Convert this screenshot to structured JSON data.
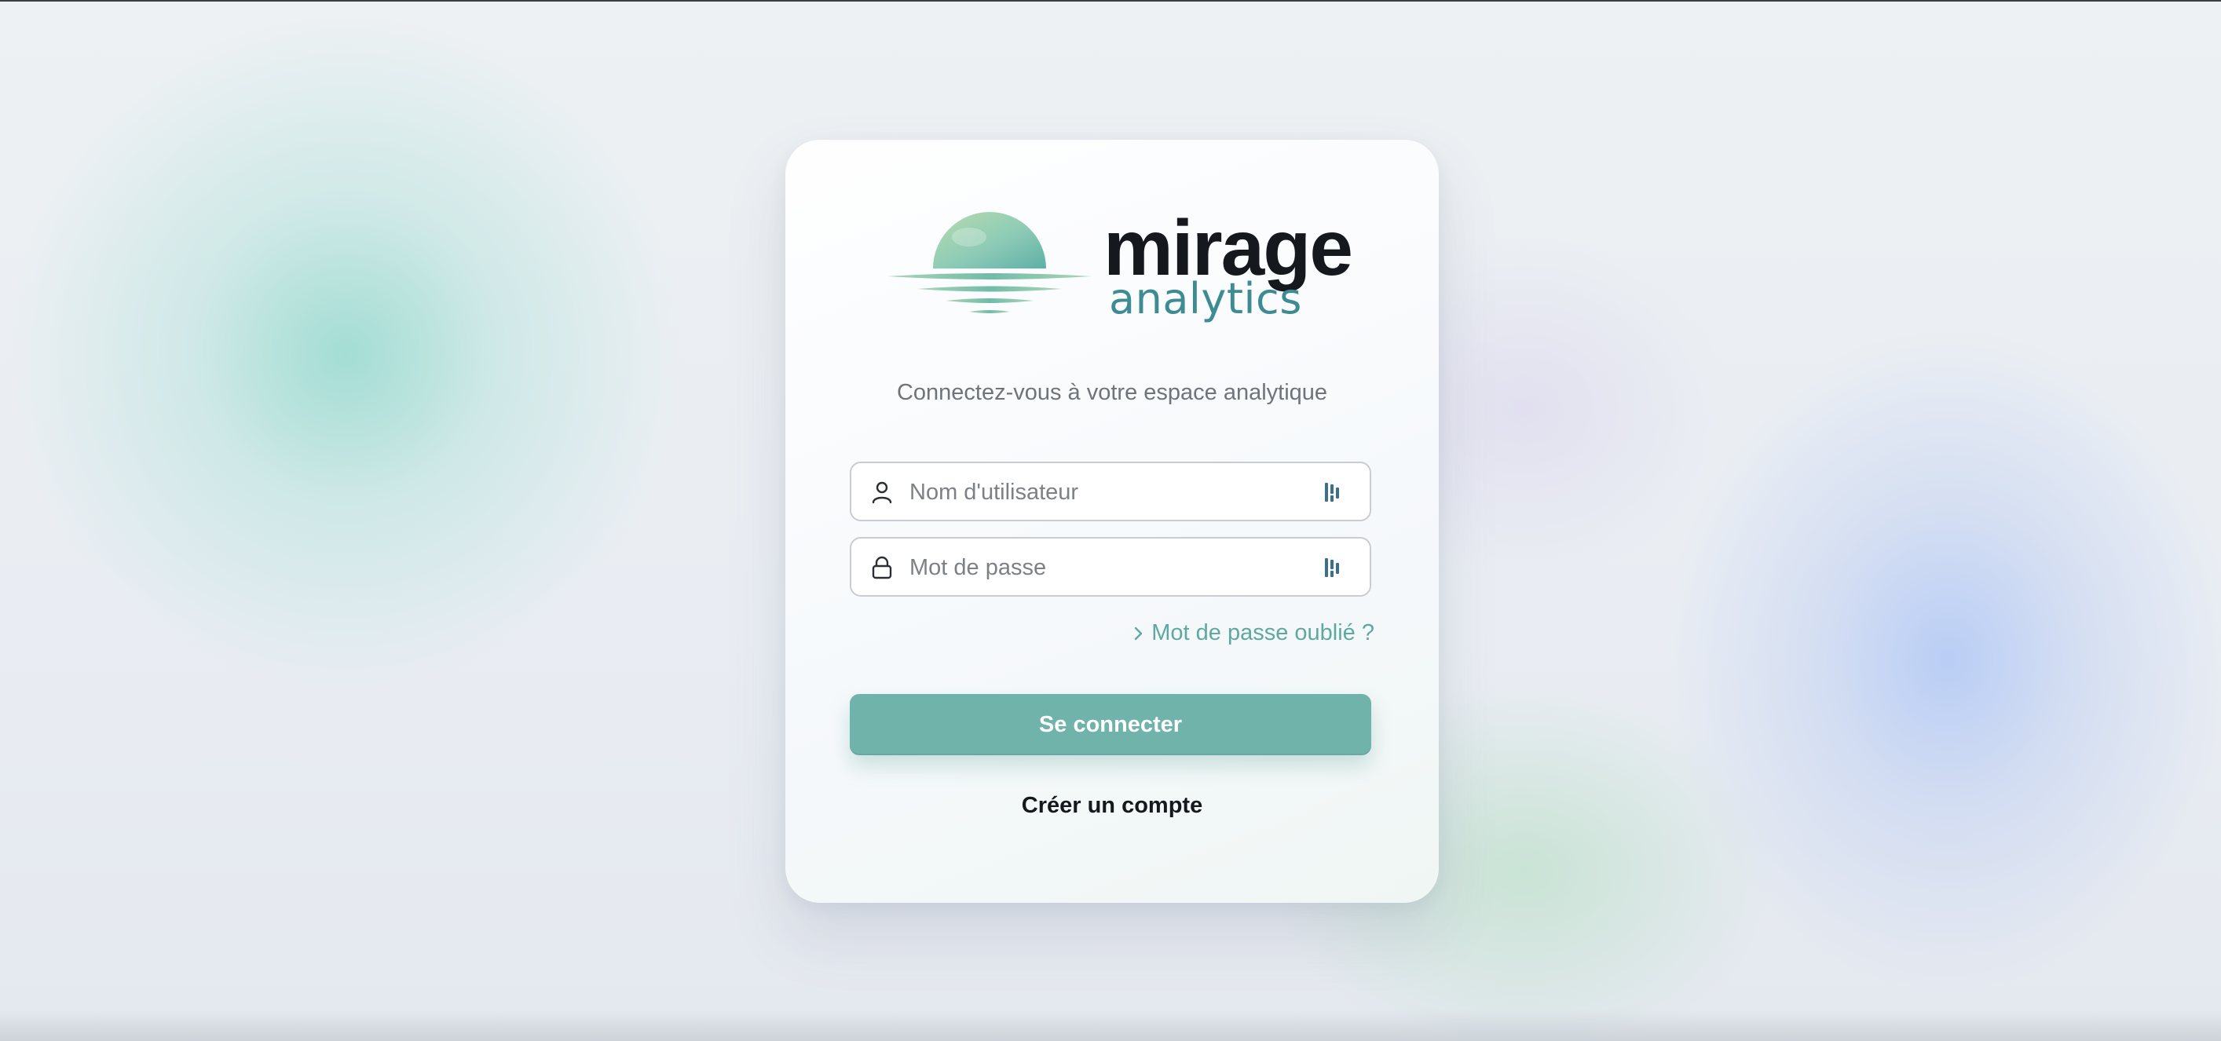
{
  "brand": {
    "name": "mirage",
    "subtitle": "analytics",
    "logo_icon": "sun-over-water-icon"
  },
  "tagline": "Connectez-vous à votre espace analytique",
  "form": {
    "username": {
      "placeholder": "Nom d'utilisateur",
      "value": "",
      "icon": "user-icon",
      "extension_icon": "password-manager-icon"
    },
    "password": {
      "placeholder": "Mot de passe",
      "value": "",
      "icon": "lock-icon",
      "extension_icon": "password-manager-icon"
    },
    "forgot_label": "Mot de passe oublié ?",
    "submit_label": "Se connecter",
    "create_account_label": "Créer un compte"
  },
  "colors": {
    "accent": "#6fb3ab",
    "link": "#5fa8a0",
    "brand_sub": "#3e8b94",
    "text_dark": "#15191d"
  }
}
